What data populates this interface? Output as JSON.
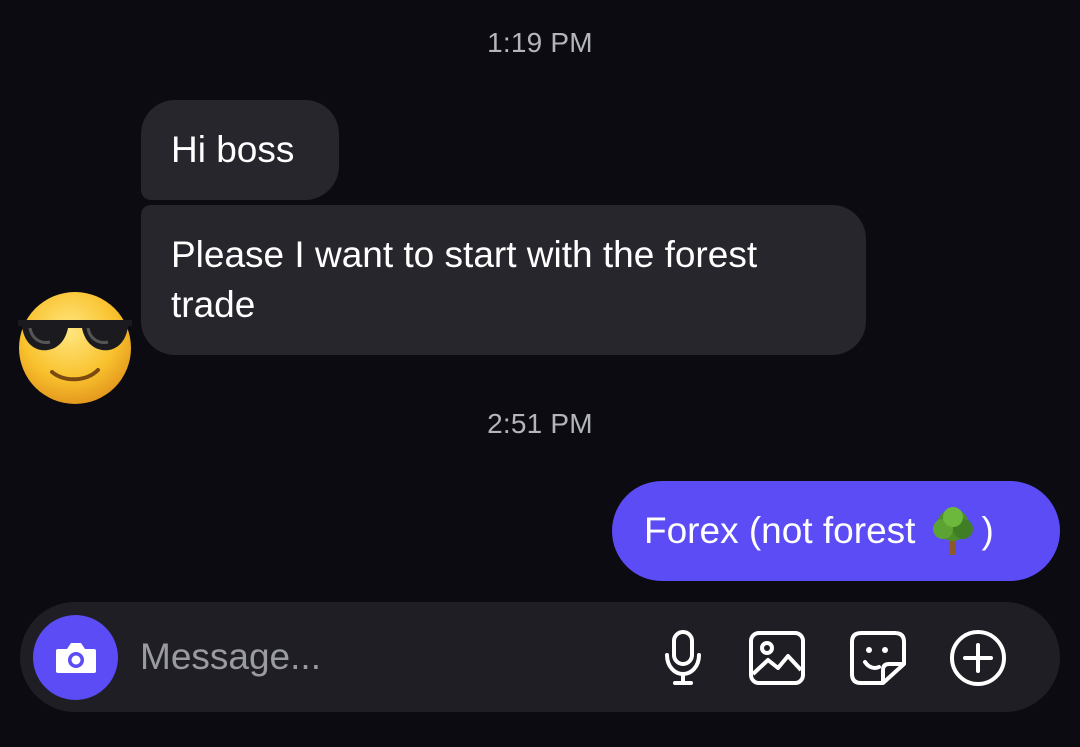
{
  "conversation": {
    "timestamps": [
      "1:19 PM",
      "2:51 PM"
    ],
    "incoming": [
      {
        "text": "Hi boss"
      },
      {
        "text": "Please I want to start with the forest trade"
      }
    ],
    "outgoing": [
      {
        "text_before_emoji": "Forex (not forest",
        "emoji": "deciduous-tree-emoji",
        "text_after_emoji": ")"
      }
    ],
    "sender_avatar": "sunglasses-face-emoji"
  },
  "composer": {
    "placeholder": "Message...",
    "value": "",
    "icons": [
      "camera-icon",
      "microphone-icon",
      "gallery-icon",
      "sticker-icon",
      "plus-circle-icon"
    ]
  },
  "colors": {
    "background": "#0b0b11",
    "incoming_bubble": "#26262c",
    "outgoing_bubble": "#5b4cf5",
    "composer": "#1e1e24",
    "timestamp": "#b4b4bc"
  }
}
